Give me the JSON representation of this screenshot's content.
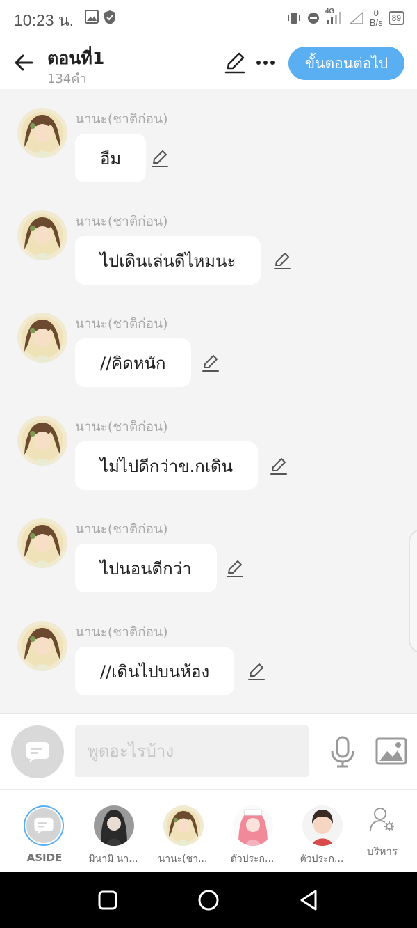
{
  "status_bar": {
    "time": "10:23 น.",
    "net_speed_value": "0",
    "net_speed_unit": "B/s",
    "battery": "89",
    "network": "4G"
  },
  "header": {
    "title": "ตอนที่1",
    "word_count": "134คำ",
    "next_button": "ขั้นตอนต่อไป"
  },
  "messages": [
    {
      "speaker": "นานะ(ชาติก่อน)",
      "text": "อืม"
    },
    {
      "speaker": "นานะ(ชาติก่อน)",
      "text": "ไปเดินเล่นดีไหมนะ"
    },
    {
      "speaker": "นานะ(ชาติก่อน)",
      "text": "//คิดหนัก"
    },
    {
      "speaker": "นานะ(ชาติก่อน)",
      "text": "ไม่ไปดีกว่าข.กเดิน"
    },
    {
      "speaker": "นานะ(ชาติก่อน)",
      "text": "ไปนอนดีกว่า"
    },
    {
      "speaker": "นานะ(ชาติก่อน)",
      "text": "//เดินไปบนห้อง"
    }
  ],
  "input": {
    "placeholder": "พูดอะไรบ้าง",
    "value": ""
  },
  "characters": [
    {
      "name": "ASIDE",
      "selected": true
    },
    {
      "name": "มินามิ นา..."
    },
    {
      "name": "นานะ(ชา..."
    },
    {
      "name": "ตัวประก..."
    },
    {
      "name": "ตัวประก..."
    }
  ],
  "manage_label": "บริหาร",
  "colors": {
    "accent": "#5aaef2",
    "background": "#f4f4f5",
    "bubble": "#ffffff",
    "speaker_text": "#a9a9a9"
  },
  "icons": [
    "back-arrow-icon",
    "pencil-icon",
    "more-dots-icon",
    "chat-bubble-icon",
    "microphone-icon",
    "image-icon",
    "user-gear-icon",
    "square-nav-icon",
    "circle-nav-icon",
    "triangle-nav-icon"
  ]
}
